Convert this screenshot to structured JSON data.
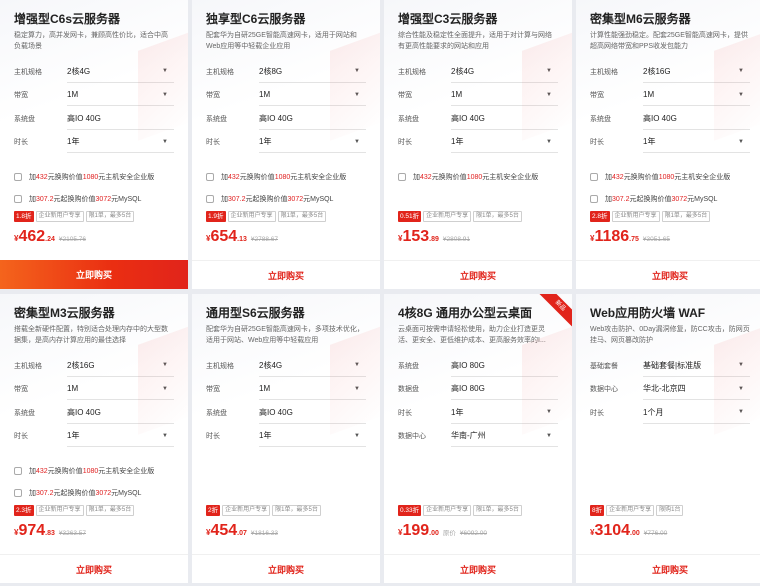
{
  "buy_label": "立即购买",
  "cards": [
    {
      "title": "增强型C6s云服务器",
      "desc": "稳定算力，高并发网卡，兼顾高性价比，适合中高负载场景",
      "specs": [
        {
          "label": "主机规格",
          "value": "2核4G"
        },
        {
          "label": "带宽",
          "value": "1M"
        },
        {
          "label": "系统盘",
          "value": "高IO 40G"
        },
        {
          "label": "时长",
          "value": "1年"
        }
      ],
      "addons": [
        {
          "pre": "加",
          "p1": "432",
          "mid": "元换购价值",
          "p2": "1080",
          "post": "元主机安全企业版"
        },
        {
          "pre": "加",
          "p1": "307.2",
          "mid": "元起换购价值",
          "p2": "3072",
          "post": "元MySQL"
        }
      ],
      "discount": "1.8折",
      "tags": [
        "企业新用户专享",
        "限1单，最多5台"
      ],
      "price_int": "462",
      "price_dec": ".24",
      "orig_label": "",
      "orig": "¥2105.76"
    },
    {
      "title": "独享型C6云服务器",
      "desc": "配套华为自研25GE智能高速网卡，适用于网站和Web应用等中轻载企业应用",
      "specs": [
        {
          "label": "主机规格",
          "value": "2核8G"
        },
        {
          "label": "带宽",
          "value": "1M"
        },
        {
          "label": "系统盘",
          "value": "高IO 40G"
        },
        {
          "label": "时长",
          "value": "1年"
        }
      ],
      "addons": [
        {
          "pre": "加",
          "p1": "432",
          "mid": "元换购价值",
          "p2": "1080",
          "post": "元主机安全企业版"
        },
        {
          "pre": "加",
          "p1": "307.2",
          "mid": "元起换购价值",
          "p2": "3072",
          "post": "元MySQL"
        }
      ],
      "discount": "1.9折",
      "tags": [
        "企业新用户专享",
        "限1单，最多5台"
      ],
      "price_int": "654",
      "price_dec": ".13",
      "orig_label": "",
      "orig": "¥2788.67"
    },
    {
      "title": "增强型C3云服务器",
      "desc": "综合性能及稳定性全面提升，适用于对计算与网络有更高性能要求的网站和应用",
      "specs": [
        {
          "label": "主机规格",
          "value": "2核4G"
        },
        {
          "label": "带宽",
          "value": "1M"
        },
        {
          "label": "系统盘",
          "value": "高IO 40G"
        },
        {
          "label": "时长",
          "value": "1年"
        }
      ],
      "addons": [
        {
          "pre": "加",
          "p1": "432",
          "mid": "元换购价值",
          "p2": "1080",
          "post": "元主机安全企业版"
        }
      ],
      "discount": "0.51折",
      "tags": [
        "企业新用户专享",
        "限1单，最多5台"
      ],
      "price_int": "153",
      "price_dec": ".89",
      "orig_label": "",
      "orig": "¥2808.91"
    },
    {
      "title": "密集型M6云服务器",
      "desc": "计算性能强劲稳定。配套25GE智能高速网卡，提供超高网络带宽和PPS收发包能力",
      "specs": [
        {
          "label": "主机规格",
          "value": "2核16G"
        },
        {
          "label": "带宽",
          "value": "1M"
        },
        {
          "label": "系统盘",
          "value": "高IO 40G"
        },
        {
          "label": "时长",
          "value": "1年"
        }
      ],
      "addons": [
        {
          "pre": "加",
          "p1": "432",
          "mid": "元换购价值",
          "p2": "1080",
          "post": "元主机安全企业版"
        },
        {
          "pre": "加",
          "p1": "307.2",
          "mid": "元起换购价值",
          "p2": "3072",
          "post": "元MySQL"
        }
      ],
      "discount": "2.8折",
      "tags": [
        "企业新用户专享",
        "限1单，最多5台"
      ],
      "price_int": "1186",
      "price_dec": ".75",
      "orig_label": "",
      "orig": "¥3051.65"
    },
    {
      "title": "密集型M3云服务器",
      "desc": "搭载全新硬件配置，特别适合处理内存中的大型数据集，是高内存计算应用的最佳选择",
      "specs": [
        {
          "label": "主机规格",
          "value": "2核16G"
        },
        {
          "label": "带宽",
          "value": "1M"
        },
        {
          "label": "系统盘",
          "value": "高IO 40G"
        },
        {
          "label": "时长",
          "value": "1年"
        }
      ],
      "addons": [
        {
          "pre": "加",
          "p1": "432",
          "mid": "元换购价值",
          "p2": "1080",
          "post": "元主机安全企业版"
        },
        {
          "pre": "加",
          "p1": "307.2",
          "mid": "元起换购价值",
          "p2": "3072",
          "post": "元MySQL"
        }
      ],
      "discount": "2.3折",
      "tags": [
        "企业新用户专享",
        "限1单，最多5台"
      ],
      "price_int": "974",
      "price_dec": ".83",
      "orig_label": "",
      "orig": "¥3263.57"
    },
    {
      "title": "通用型S6云服务器",
      "desc": "配套华为自研25GE智能高速网卡，多项技术优化，适用于网站、Web应用等中轻载应用",
      "specs": [
        {
          "label": "主机规格",
          "value": "2核4G"
        },
        {
          "label": "带宽",
          "value": "1M"
        },
        {
          "label": "系统盘",
          "value": "高IO 40G"
        },
        {
          "label": "时长",
          "value": "1年"
        }
      ],
      "addons": [],
      "discount": "2折",
      "tags": [
        "企业新用户专享",
        "限1单，最多5台"
      ],
      "price_int": "454",
      "price_dec": ".07",
      "orig_label": "",
      "orig": "¥1816.33"
    },
    {
      "title": "4核8G 通用办公型云桌面",
      "desc": "云桌面可按需申请轻松使用，助力企业打造更灵活、更安全、更低维护成本、更高服务效率的I...",
      "ribbon": "新品",
      "specs": [
        {
          "label": "系统盘",
          "value": "高IO 80G"
        },
        {
          "label": "数据盘",
          "value": "高IO 80G"
        },
        {
          "label": "时长",
          "value": "1年"
        },
        {
          "label": "数据中心",
          "value": "华南-广州"
        }
      ],
      "addons": [],
      "discount": "0.33折",
      "tags": [
        "企业新用户专享",
        "限1单，最多5台"
      ],
      "price_int": "199",
      "price_dec": ".00",
      "orig_label": "原价",
      "orig": "¥6092.00"
    },
    {
      "title": "Web应用防火墙 WAF",
      "desc": "Web攻击防护、0Day漏洞修复，防CC攻击，防网页挂马、网页篡改防护",
      "specs": [
        {
          "label": "基础套餐",
          "value": "基础套餐|标准版"
        },
        {
          "label": "数据中心",
          "value": "华北-北京四"
        },
        {
          "label": "时长",
          "value": "1个月"
        }
      ],
      "addons": [],
      "discount": "8折",
      "tags": [
        "企业新用户专享",
        "限购1台"
      ],
      "price_int": "3104",
      "price_dec": ".00",
      "orig_label": "",
      "orig": "¥776.00"
    }
  ]
}
